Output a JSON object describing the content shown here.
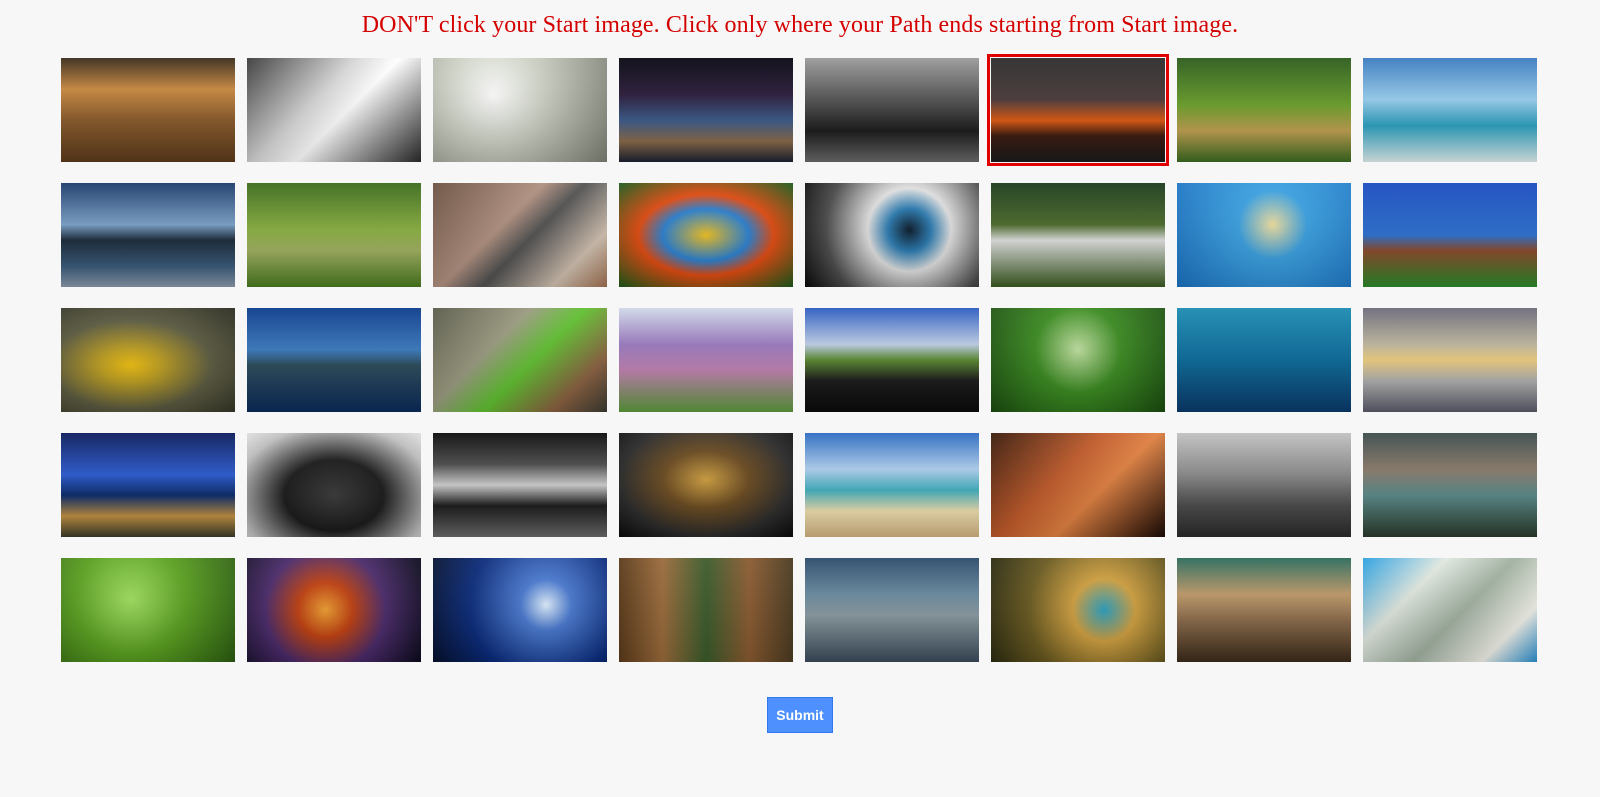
{
  "instruction": "DON'T click your Start image. Click only where your Path ends starting from Start image.",
  "submit_label": "Submit",
  "colors": {
    "instruction_text": "#d40000",
    "selection_border": "#e00000",
    "submit_bg": "#4d90fe",
    "page_bg": "#f7f7f7"
  },
  "images": [
    {
      "name": "city-square-image",
      "bg": "linear-gradient(180deg,#3a2a1a 0%,#c9893f 30%,#8a5a2a 60%,#5a3a1a 100%)",
      "selected": false
    },
    {
      "name": "vintage-car-bw-image",
      "bg": "linear-gradient(135deg,#3a3a3a 0%,#d8d8d8 40%,#ffffff 55%,#2a2a2a 100%)",
      "selected": false
    },
    {
      "name": "silver-concept-car-image",
      "bg": "radial-gradient(circle at 35% 35%,#ffffff 0%,#d0d4c8 35%,#7a7e72 100%)",
      "selected": false
    },
    {
      "name": "earth-from-space-image",
      "bg": "linear-gradient(180deg,#05050f 0%,#2a1a3a 35%,#3a5a8a 60%,#8a6a4a 80%,#1a2030 100%)",
      "selected": false
    },
    {
      "name": "sailing-ship-image",
      "bg": "linear-gradient(180deg,#9a9a9a 0%,#4a4a4a 45%,#1a1a1a 70%,#6a6a6a 100%)",
      "selected": false
    },
    {
      "name": "sunset-lake-image",
      "bg": "linear-gradient(180deg,#2a2a2a 0%,#4a3a3a 40%,#e05a10 60%,#3a1a10 75%,#1a1a1a 100%)",
      "selected": true
    },
    {
      "name": "dwarfs-cartoon-image",
      "bg": "linear-gradient(180deg,#2a5a1a 0%,#6aa02a 45%,#c0a050 70%,#3a6a20 100%)",
      "selected": false
    },
    {
      "name": "tropical-beach-image",
      "bg": "linear-gradient(180deg,#3a7ac0 0%,#9ad0f0 40%,#2aa0c0 65%,#e0f0f0 100%)",
      "selected": false
    },
    {
      "name": "mountain-lake-image",
      "bg": "linear-gradient(180deg,#1a3a6a 0%,#7aa0c8 40%,#1a2a3a 55%,#3a5a7a 80%,#8a9aaa 100%)",
      "selected": false
    },
    {
      "name": "snow-white-dwarfs-image",
      "bg": "linear-gradient(180deg,#3a6a1a 0%,#8ab040 45%,#a0b060 65%,#4a7a20 100%)",
      "selected": false
    },
    {
      "name": "rifle-image",
      "bg": "linear-gradient(135deg,#6a5040 0%,#b09080 40%,#505050 55%,#d0c0b0 80%,#a07050 100%)",
      "selected": false
    },
    {
      "name": "colorful-fish-image",
      "bg": "radial-gradient(ellipse at 50% 50%,#f0c020 0%,#2a80d0 35%,#e04a10 55%,#1a5a1a 100%)",
      "selected": false
    },
    {
      "name": "eye-closeup-image",
      "bg": "radial-gradient(circle at 60% 45%,#0a1a2a 0%,#2a7ab0 18%,#e0e0e0 35%,#4a4a4a 70%,#0a0a0a 100%)",
      "selected": false
    },
    {
      "name": "birds-family-image",
      "bg": "linear-gradient(180deg,#1a3a1a 0%,#4a6a2a 40%,#e0e0e0 55%,#3a5a20 100%)",
      "selected": false
    },
    {
      "name": "butterflyfish-image",
      "bg": "radial-gradient(circle at 55% 40%,#f0e0a0 0%,#3aa0e0 30%,#1a70c0 100%)",
      "selected": false
    },
    {
      "name": "fantasy-house-image",
      "bg": "linear-gradient(180deg,#1a4ac0 0%,#2a70d0 50%,#8a4a2a 65%,#2a8a2a 100%)",
      "selected": false
    },
    {
      "name": "yellow-fish-image",
      "bg": "radial-gradient(ellipse at 40% 55%,#f0c010 0%,#c0a020 20%,#5a5a40 55%,#2a2a20 100%)",
      "selected": false
    },
    {
      "name": "blue-lake-image",
      "bg": "linear-gradient(180deg,#0a3a8a 0%,#3a7ac0 40%,#2a4a5a 55%,#0a2a5a 100%)",
      "selected": false
    },
    {
      "name": "green-parrot-image",
      "bg": "linear-gradient(135deg,#5a5a4a 0%,#9a9a80 35%,#60c030 55%,#8a6040 80%,#3a3a30 100%)",
      "selected": false
    },
    {
      "name": "blossom-trees-image",
      "bg": "linear-gradient(180deg,#d0d8e8 0%,#9a7ac0 35%,#c080b0 60%,#5a9a3a 100%)",
      "selected": false
    },
    {
      "name": "open-road-image",
      "bg": "linear-gradient(180deg,#2a5ac0 0%,#c0d0e8 35%,#5a8a30 50%,#1a1a1a 70%,#0a0a0a 100%)",
      "selected": false
    },
    {
      "name": "heart-in-grass-image",
      "bg": "radial-gradient(circle at 50% 40%,#c0e0a0 0%,#3a8a20 40%,#1a4a10 100%)",
      "selected": false
    },
    {
      "name": "shark-underwater-image",
      "bg": "linear-gradient(180deg,#1a8ab0 0%,#0a6a9a 50%,#0a3a6a 100%)",
      "selected": false
    },
    {
      "name": "cloud-reflection-image",
      "bg": "linear-gradient(180deg,#6a6a7a 0%,#c0b8a0 35%,#f0d080 50%,#b0b0b0 70%,#5a5a6a 100%)",
      "selected": false
    },
    {
      "name": "night-beach-image",
      "bg": "linear-gradient(180deg,#0a1a5a 0%,#2a5ad0 40%,#0a2a6a 60%,#c09040 80%,#3a3a2a 100%)",
      "selected": false
    },
    {
      "name": "black-sports-car-image",
      "bg": "radial-gradient(ellipse at 50% 60%,#3a3a3a 0%,#1a1a1a 40%,#c0c0c0 80%,#e0e0e0 100%)",
      "selected": false
    },
    {
      "name": "snowy-forest-image",
      "bg": "linear-gradient(180deg,#0a0a0a 0%,#4a4a4a 30%,#d0d0d0 50%,#1a1a1a 70%,#6a6a6a 100%)",
      "selected": false
    },
    {
      "name": "car-dashboard-image",
      "bg": "radial-gradient(ellipse at 50% 45%,#d0a040 0%,#6a4a20 35%,#2a2a2a 70%,#0a0a0a 100%)",
      "selected": false
    },
    {
      "name": "beach-umbrella-image",
      "bg": "linear-gradient(180deg,#2a6ac0 0%,#b0d0f0 35%,#40b0c0 55%,#f0e0b0 75%,#d0b080 100%)",
      "selected": false
    },
    {
      "name": "anime-warrior-image",
      "bg": "linear-gradient(135deg,#3a1a0a 0%,#c05a2a 40%,#e08040 60%,#1a0a05 100%)",
      "selected": false
    },
    {
      "name": "new-york-skyline-image",
      "bg": "linear-gradient(180deg,#c0c0c0 0%,#8a8a8a 40%,#4a4a4a 70%,#2a2a2a 100%)",
      "selected": false
    },
    {
      "name": "alice-wonderland-image",
      "bg": "linear-gradient(180deg,#3a4a4a 0%,#8a7a6a 35%,#5a8a8a 60%,#2a3a2a 100%)",
      "selected": false
    },
    {
      "name": "clover-leaves-image",
      "bg": "radial-gradient(circle at 40% 40%,#a0e060 0%,#5aa020 45%,#2a5a10 100%)",
      "selected": false
    },
    {
      "name": "anime-fight-image",
      "bg": "radial-gradient(circle at 45% 50%,#f0a030 0%,#c04010 25%,#4a2a6a 55%,#0a0a1a 100%)",
      "selected": false
    },
    {
      "name": "moonlit-sea-image",
      "bg": "radial-gradient(circle at 65% 45%,#e0f0ff 0%,#4a7ad0 20%,#0a2a7a 60%,#05102a 100%)",
      "selected": false
    },
    {
      "name": "redwood-road-image",
      "bg": "linear-gradient(90deg,#5a3a1a 0%,#9a6a3a 25%,#3a5a2a 50%,#8a5a30 75%,#4a3a20 100%)",
      "selected": false
    },
    {
      "name": "city-aerial-image",
      "bg": "linear-gradient(180deg,#2a4a6a 0%,#6a8aa0 35%,#8a9aa0 55%,#3a4a5a 100%)",
      "selected": false
    },
    {
      "name": "kingfisher-image",
      "bg": "radial-gradient(circle at 65% 50%,#2aa0c0 0%,#d0a040 25%,#6a5a20 60%,#2a2a10 100%)",
      "selected": false
    },
    {
      "name": "grand-central-image",
      "bg": "linear-gradient(180deg,#2a6a5a 0%,#c09a6a 35%,#8a6a4a 60%,#3a2a1a 100%)",
      "selected": false
    },
    {
      "name": "twenty-dollar-bill-image",
      "bg": "linear-gradient(135deg,#2aa0e0 0%,#e0e8e0 30%,#a0b0a0 55%,#f0f0e8 80%,#2a90d0 100%)",
      "selected": false
    }
  ]
}
